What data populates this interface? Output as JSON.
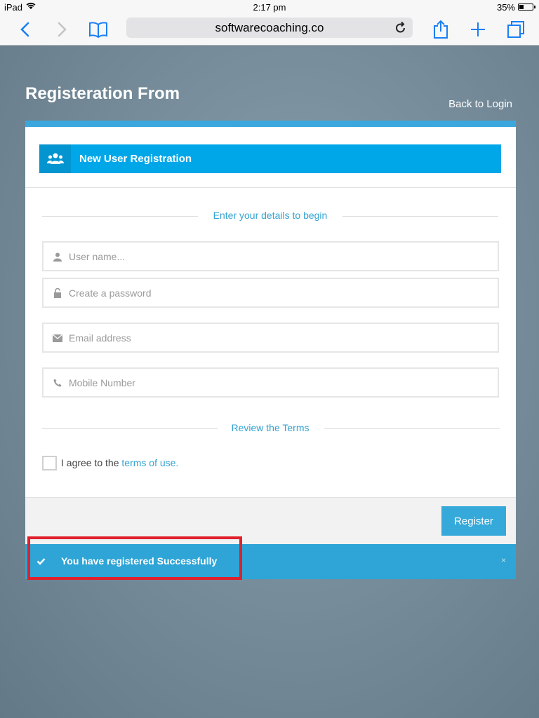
{
  "status_bar": {
    "device": "iPad",
    "time": "2:17 pm",
    "battery": "35%"
  },
  "browser": {
    "url": "softwarecoaching.co",
    "icons": [
      "back-icon",
      "forward-icon",
      "bookmarks-icon",
      "reload-icon",
      "share-icon",
      "new-tab-icon",
      "tabs-icon"
    ]
  },
  "page": {
    "title": "Registeration From",
    "back_link": "Back to Login"
  },
  "card": {
    "header_title": "New User Registration",
    "section1_heading": "Enter your details to begin",
    "fields": {
      "username_placeholder": "User name...",
      "password_placeholder": "Create a password",
      "email_placeholder": "Email address",
      "mobile_placeholder": "Mobile Number"
    },
    "section2_heading": "Review the Terms",
    "terms_prefix": "I agree to the",
    "terms_link": "terms of use.",
    "register_label": "Register"
  },
  "alert": {
    "message": "You have registered Successfully",
    "close": "×"
  },
  "colors": {
    "accent": "#00a7e8",
    "header_icon_bg": "#0494cf",
    "alert_bg": "#2ea5d6",
    "highlight_border": "#e0202b",
    "ios_blue": "#1a7ff5"
  }
}
